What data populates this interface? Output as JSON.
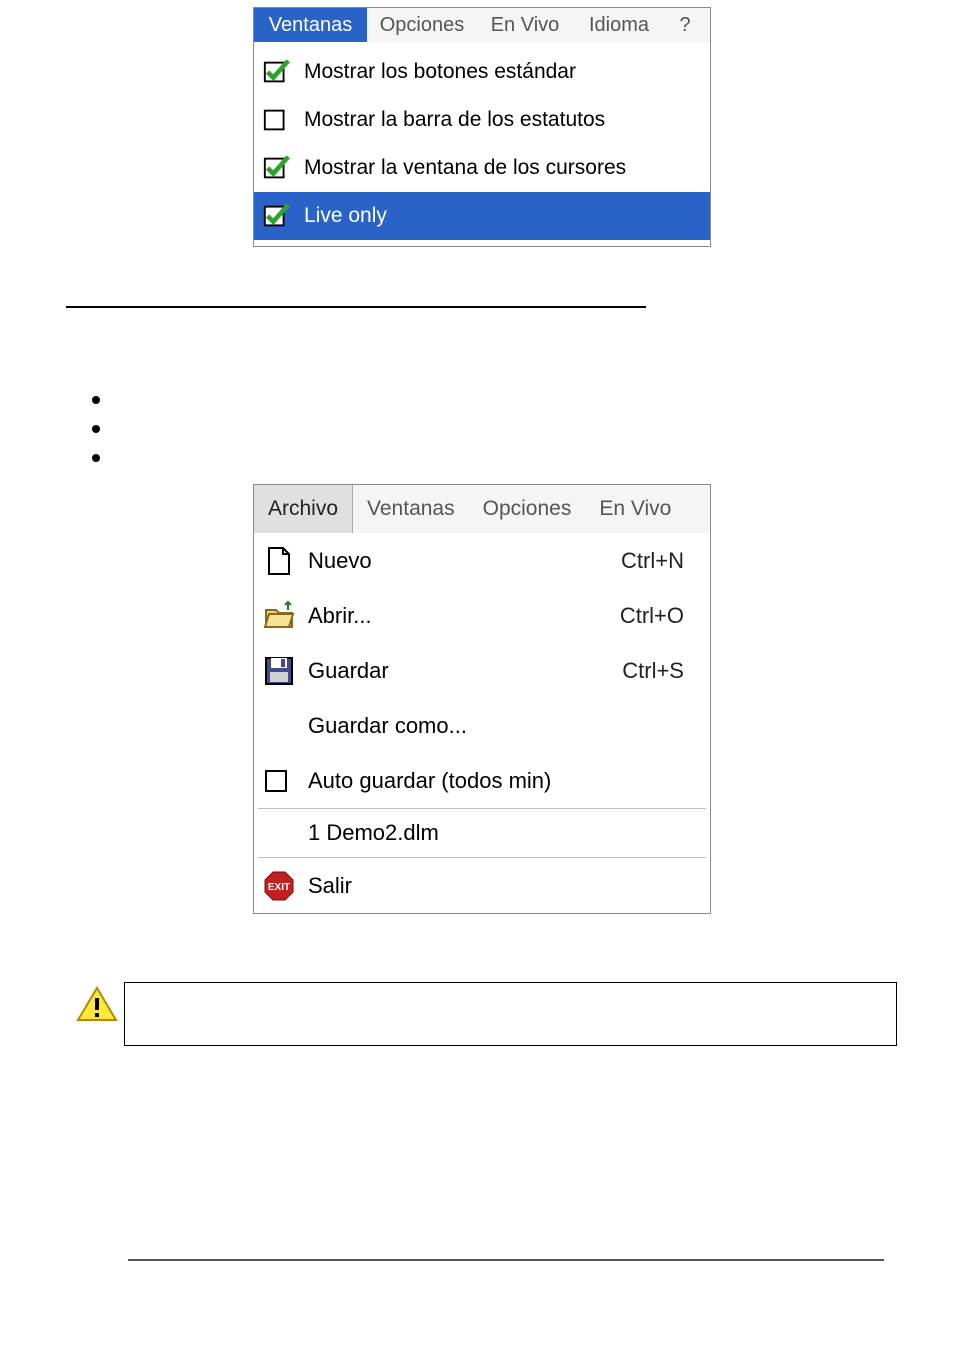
{
  "menu1": {
    "bar": [
      "Ventanas",
      "Opciones",
      "En Vivo",
      "Idioma",
      "?"
    ],
    "active_index": 0,
    "items": [
      {
        "label": "Mostrar los botones estándar",
        "checked": true,
        "highlight": false
      },
      {
        "label": "Mostrar la barra de los estatutos",
        "checked": false,
        "highlight": false
      },
      {
        "label": "Mostrar la ventana de los cursores",
        "checked": true,
        "highlight": false
      },
      {
        "label": "Live only",
        "checked": true,
        "highlight": true
      }
    ]
  },
  "menu2": {
    "bar": [
      "Archivo",
      "Ventanas",
      "Opciones",
      "En Vivo"
    ],
    "active_index": 0,
    "items": [
      {
        "icon": "file-new-icon",
        "label": "Nuevo",
        "shortcut": "Ctrl+N"
      },
      {
        "icon": "folder-open-icon",
        "label": "Abrir...",
        "shortcut": "Ctrl+O"
      },
      {
        "icon": "save-icon",
        "label": "Guardar",
        "shortcut": "Ctrl+S"
      },
      {
        "icon": null,
        "label": "Guardar como...",
        "shortcut": ""
      },
      {
        "icon": "checkbox-empty-icon",
        "label": "Auto guardar (todos min)",
        "shortcut": ""
      },
      {
        "separator": true
      },
      {
        "icon": null,
        "label": "1 Demo2.dlm",
        "shortcut": "",
        "recent": true
      },
      {
        "separator": true
      },
      {
        "icon": "exit-icon",
        "label": "Salir",
        "shortcut": ""
      }
    ]
  },
  "warning_text": ""
}
